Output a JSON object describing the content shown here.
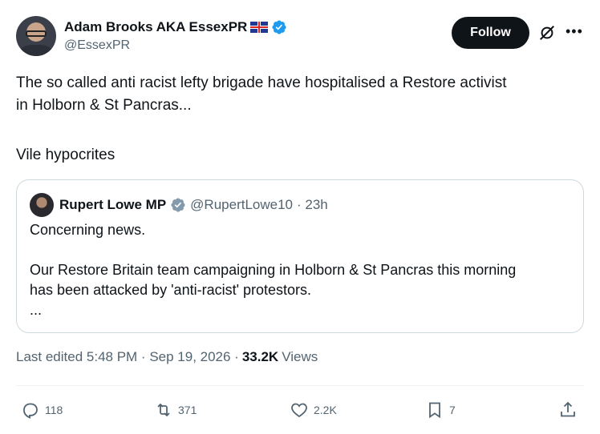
{
  "author": {
    "display_name": "Adam Brooks AKA EssexPR",
    "flag_icon": "uk-flag-icon",
    "verified_icon": "verified-badge-icon",
    "handle": "@EssexPR"
  },
  "follow_label": "Follow",
  "tweet": {
    "line1": "The so called anti racist lefty brigade have hospitalised a Restore activist",
    "line2": "in Holborn & St Pancras...",
    "line3": "Vile hypocrites"
  },
  "quote": {
    "name": "Rupert Lowe MP",
    "handle": "@RupertLowe10",
    "time": "· 23h",
    "line1": "Concerning news.",
    "line2": "Our Restore Britain team campaigning in Holborn & St Pancras this morning",
    "line3": "has been attacked by 'anti-racist' protestors.",
    "line4": "..."
  },
  "meta": {
    "edited": "Last edited 5:48 PM · Sep 19, 2026 ·",
    "views_count": "33.2K",
    "views_label": "Views"
  },
  "actions": {
    "replies": "118",
    "reposts": "371",
    "likes": "2.2K",
    "bookmarks": "7"
  },
  "colors": {
    "verified_blue": "#1d9bf0",
    "secondary_text": "#536471",
    "primary_text": "#0f1419"
  }
}
